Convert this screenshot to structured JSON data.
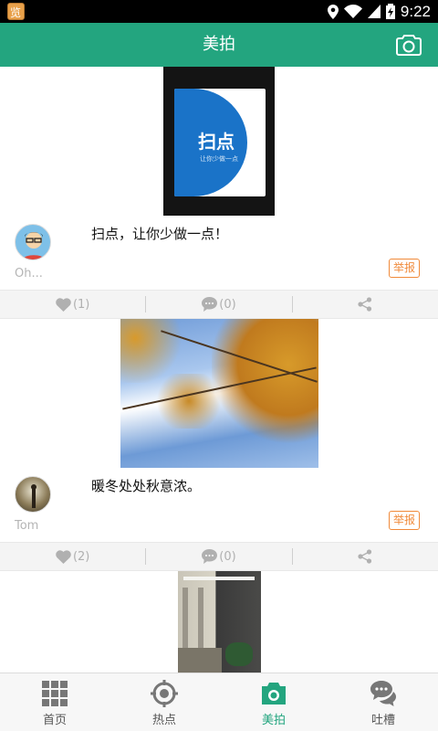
{
  "status_bar": {
    "time": "9:22"
  },
  "header": {
    "title": "美拍",
    "camera_icon": "camera-icon"
  },
  "posts": [
    {
      "caption": "扫点，让你少做一点！",
      "username": "Oh...",
      "report_label": "举报",
      "photo_text": "扫点",
      "photo_subtext": "让你少做一点",
      "likes": "(1)",
      "comments": "(0)"
    },
    {
      "caption": "暖冬处处秋意浓。",
      "username": "Tom",
      "report_label": "举报",
      "likes": "(2)",
      "comments": "(0)"
    }
  ],
  "nav": {
    "items": [
      {
        "label": "首页",
        "icon": "grid-icon"
      },
      {
        "label": "热点",
        "icon": "target-icon"
      },
      {
        "label": "美拍",
        "icon": "camera-icon",
        "active": true
      },
      {
        "label": "吐槽",
        "icon": "chat-bubbles-icon"
      }
    ]
  },
  "colors": {
    "brand": "#23a57f",
    "report": "#f08a3a"
  }
}
